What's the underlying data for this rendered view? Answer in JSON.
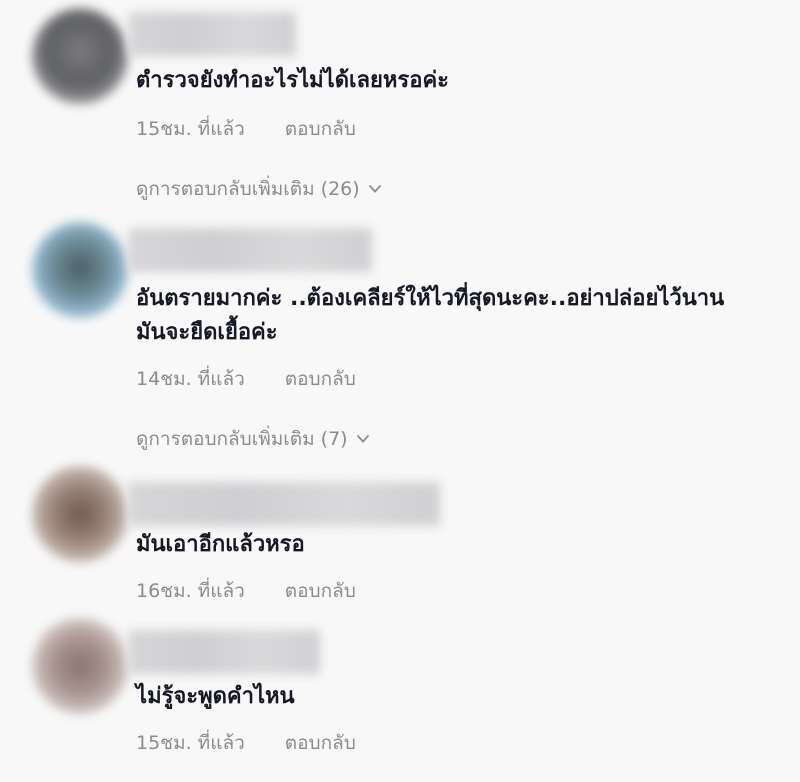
{
  "comments": [
    {
      "text": "ตำรวจยังทำอะไรไม่ได้เลยหรอค่ะ",
      "time": "15ชม. ที่แล้ว",
      "reply": "ตอบกลับ",
      "view_more": "ดูการตอบกลับเพิ่มเติม (26)"
    },
    {
      "text": "อันตรายมากค่ะ ..ต้องเคลียร์ให้ไวที่สุดนะคะ..อย่าปล่อยไว้นาน มันจะยืดเยื้อค่ะ",
      "time": "14ชม. ที่แล้ว",
      "reply": "ตอบกลับ",
      "view_more": "ดูการตอบกลับเพิ่มเติม (7)"
    },
    {
      "text": "มันเอาอีกแล้วหรอ",
      "time": "16ชม. ที่แล้ว",
      "reply": "ตอบกลับ"
    },
    {
      "text": "ไม่รู้จะพูดคำไหน",
      "time": "15ชม. ที่แล้ว",
      "reply": "ตอบกลับ"
    }
  ],
  "colors": {
    "background": "#f8f8f8",
    "text": "#161823",
    "meta": "#8a8b91"
  }
}
